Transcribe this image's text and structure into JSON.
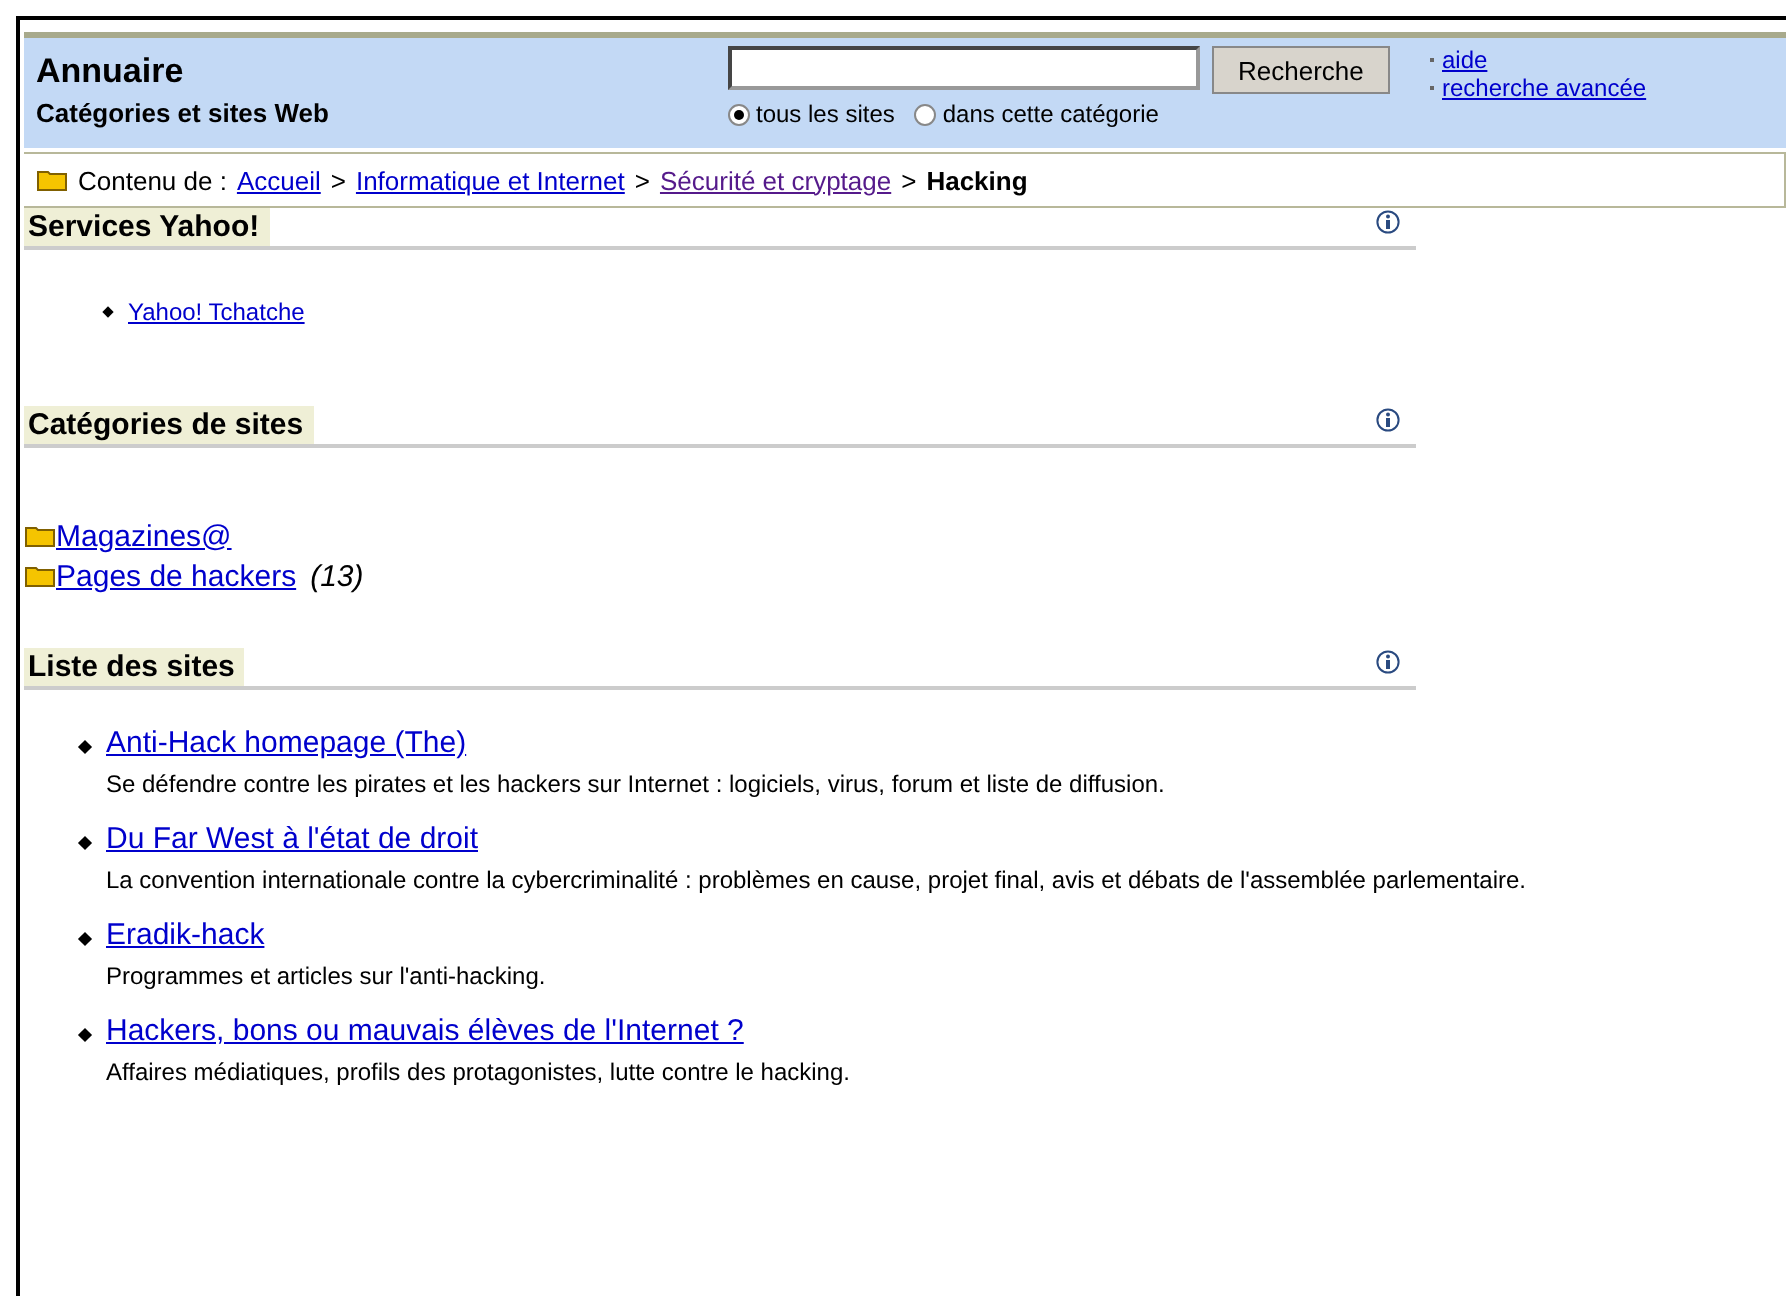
{
  "header": {
    "title": "Annuaire",
    "subtitle": "Catégories et sites Web",
    "search": {
      "button": "Recherche",
      "scopes": [
        {
          "label": "tous les sites",
          "selected": true
        },
        {
          "label": "dans cette catégorie",
          "selected": false
        }
      ]
    },
    "links": [
      "aide",
      "recherche avancée"
    ]
  },
  "breadcrumb": {
    "label": "Contenu de :",
    "separator": ">",
    "items": [
      {
        "text": "Accueil",
        "kind": "link",
        "visited": false
      },
      {
        "text": "Informatique et Internet",
        "kind": "link",
        "visited": false
      },
      {
        "text": "Sécurité et cryptage",
        "kind": "link",
        "visited": true
      },
      {
        "text": "Hacking",
        "kind": "current"
      }
    ]
  },
  "sections": [
    {
      "title": "Services Yahoo!",
      "kind": "services",
      "items": [
        {
          "title": "Yahoo! Tchatche"
        }
      ]
    },
    {
      "title": "Catégories de sites",
      "kind": "categories",
      "items": [
        {
          "title": "Magazines@"
        },
        {
          "title": "Pages de hackers",
          "count": "(13)"
        }
      ]
    },
    {
      "title": "Liste des sites",
      "kind": "sites",
      "items": [
        {
          "title": "Anti-Hack homepage (The)",
          "description": "Se défendre contre les pirates et les hackers sur Internet : logiciels, virus, forum et liste de diffusion."
        },
        {
          "title": "Du Far West à l'état de droit",
          "description": "La convention internationale contre la cybercriminalité : problèmes en cause, projet final, avis et débats de l'assemblée parlementaire."
        },
        {
          "title": "Eradik-hack",
          "description": "Programmes et articles sur l'anti-hacking."
        },
        {
          "title": "Hackers, bons ou mauvais élèves de l'Internet ?",
          "description": "Affaires médiatiques, profils des protagonistes, lutte contre le hacking."
        }
      ]
    }
  ]
}
